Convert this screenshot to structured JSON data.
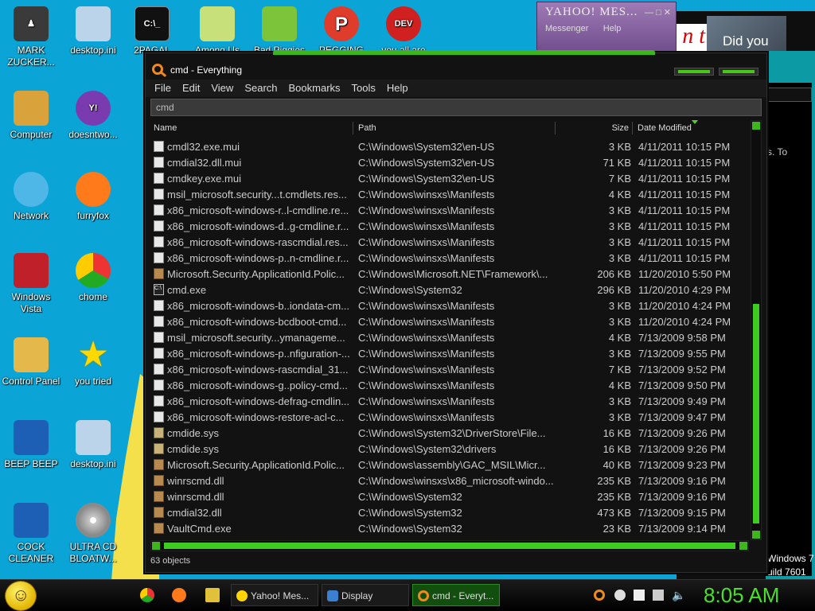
{
  "desktop_icons": [
    {
      "name": "desktop-icon-mark-zuckerberg",
      "label": "MARK ZUCKER..."
    },
    {
      "name": "desktop-icon-desktop-ini-1",
      "label": "desktop.ini"
    },
    {
      "name": "desktop-icon-2pagal",
      "label": "2PAGAL"
    },
    {
      "name": "desktop-icon-among-us",
      "label": "Among Us"
    },
    {
      "name": "desktop-icon-bad-piggies",
      "label": "Bad Piggies"
    },
    {
      "name": "desktop-icon-pegging",
      "label": "PEGGING"
    },
    {
      "name": "desktop-icon-you-all-are",
      "label": "you all are"
    },
    {
      "name": "desktop-icon-computer",
      "label": "Computer"
    },
    {
      "name": "desktop-icon-doesntwo",
      "label": "doesntwo..."
    },
    {
      "name": "desktop-icon-network",
      "label": "Network"
    },
    {
      "name": "desktop-icon-furryfox",
      "label": "furryfox"
    },
    {
      "name": "desktop-icon-windows-vista",
      "label": "Windows Vista"
    },
    {
      "name": "desktop-icon-chome",
      "label": "chome"
    },
    {
      "name": "desktop-icon-control-panel",
      "label": "Control Panel"
    },
    {
      "name": "desktop-icon-you-tried",
      "label": "you tried"
    },
    {
      "name": "desktop-icon-beep-beep",
      "label": "BEEP BEEP"
    },
    {
      "name": "desktop-icon-desktop-ini-2",
      "label": "desktop.ini"
    },
    {
      "name": "desktop-icon-cock-cleaner",
      "label": "COCK CLEANER"
    },
    {
      "name": "desktop-icon-ultra-cd",
      "label": "ULTRA CD BLOATW..."
    }
  ],
  "yahoo_window": {
    "title": "YAHOO! MES...",
    "menu_messenger": "Messenger",
    "menu_help": "Help"
  },
  "bg_window": {
    "photo_text": "Did you",
    "side_text": "s. To",
    "version_line1": "Windows 7",
    "version_line2": "uild 7601"
  },
  "everything": {
    "title": "cmd - Everything",
    "menu": [
      "File",
      "Edit",
      "View",
      "Search",
      "Bookmarks",
      "Tools",
      "Help"
    ],
    "search_value": "cmd",
    "columns": {
      "name": "Name",
      "path": "Path",
      "size": "Size",
      "date": "Date Modified"
    },
    "rows": [
      {
        "icon": "file",
        "name": "cmdl32.exe.mui",
        "path": "C:\\Windows\\System32\\en-US",
        "size": "3 KB",
        "date": "4/11/2011 10:15 PM"
      },
      {
        "icon": "file",
        "name": "cmdial32.dll.mui",
        "path": "C:\\Windows\\System32\\en-US",
        "size": "71 KB",
        "date": "4/11/2011 10:15 PM"
      },
      {
        "icon": "file",
        "name": "cmdkey.exe.mui",
        "path": "C:\\Windows\\System32\\en-US",
        "size": "7 KB",
        "date": "4/11/2011 10:15 PM"
      },
      {
        "icon": "file",
        "name": "msil_microsoft.security...t.cmdlets.res...",
        "path": "C:\\Windows\\winsxs\\Manifests",
        "size": "4 KB",
        "date": "4/11/2011 10:15 PM"
      },
      {
        "icon": "file",
        "name": "x86_microsoft-windows-r..l-cmdline.re...",
        "path": "C:\\Windows\\winsxs\\Manifests",
        "size": "3 KB",
        "date": "4/11/2011 10:15 PM"
      },
      {
        "icon": "file",
        "name": "x86_microsoft-windows-d..g-cmdline.r...",
        "path": "C:\\Windows\\winsxs\\Manifests",
        "size": "3 KB",
        "date": "4/11/2011 10:15 PM"
      },
      {
        "icon": "file",
        "name": "x86_microsoft-windows-rascmdial.res...",
        "path": "C:\\Windows\\winsxs\\Manifests",
        "size": "3 KB",
        "date": "4/11/2011 10:15 PM"
      },
      {
        "icon": "file",
        "name": "x86_microsoft-windows-p..n-cmdline.r...",
        "path": "C:\\Windows\\winsxs\\Manifests",
        "size": "3 KB",
        "date": "4/11/2011 10:15 PM"
      },
      {
        "icon": "dll",
        "name": "Microsoft.Security.ApplicationId.Polic...",
        "path": "C:\\Windows\\Microsoft.NET\\Framework\\...",
        "size": "206 KB",
        "date": "11/20/2010 5:50 PM"
      },
      {
        "icon": "exe",
        "name": "cmd.exe",
        "path": "C:\\Windows\\System32",
        "size": "296 KB",
        "date": "11/20/2010 4:29 PM"
      },
      {
        "icon": "file",
        "name": "x86_microsoft-windows-b..iondata-cm...",
        "path": "C:\\Windows\\winsxs\\Manifests",
        "size": "3 KB",
        "date": "11/20/2010 4:24 PM"
      },
      {
        "icon": "file",
        "name": "x86_microsoft-windows-bcdboot-cmd...",
        "path": "C:\\Windows\\winsxs\\Manifests",
        "size": "3 KB",
        "date": "11/20/2010 4:24 PM"
      },
      {
        "icon": "file",
        "name": "msil_microsoft.security...ymanageme...",
        "path": "C:\\Windows\\winsxs\\Manifests",
        "size": "4 KB",
        "date": "7/13/2009 9:58 PM"
      },
      {
        "icon": "file",
        "name": "x86_microsoft-windows-p..nfiguration-...",
        "path": "C:\\Windows\\winsxs\\Manifests",
        "size": "3 KB",
        "date": "7/13/2009 9:55 PM"
      },
      {
        "icon": "file",
        "name": "x86_microsoft-windows-rascmdial_31...",
        "path": "C:\\Windows\\winsxs\\Manifests",
        "size": "7 KB",
        "date": "7/13/2009 9:52 PM"
      },
      {
        "icon": "file",
        "name": "x86_microsoft-windows-g..policy-cmd...",
        "path": "C:\\Windows\\winsxs\\Manifests",
        "size": "4 KB",
        "date": "7/13/2009 9:50 PM"
      },
      {
        "icon": "file",
        "name": "x86_microsoft-windows-defrag-cmdlin...",
        "path": "C:\\Windows\\winsxs\\Manifests",
        "size": "3 KB",
        "date": "7/13/2009 9:49 PM"
      },
      {
        "icon": "file",
        "name": "x86_microsoft-windows-restore-acl-c...",
        "path": "C:\\Windows\\winsxs\\Manifests",
        "size": "3 KB",
        "date": "7/13/2009 9:47 PM"
      },
      {
        "icon": "sys",
        "name": "cmdide.sys",
        "path": "C:\\Windows\\System32\\DriverStore\\File...",
        "size": "16 KB",
        "date": "7/13/2009 9:26 PM"
      },
      {
        "icon": "sys",
        "name": "cmdide.sys",
        "path": "C:\\Windows\\System32\\drivers",
        "size": "16 KB",
        "date": "7/13/2009 9:26 PM"
      },
      {
        "icon": "dll",
        "name": "Microsoft.Security.ApplicationId.Polic...",
        "path": "C:\\Windows\\assembly\\GAC_MSIL\\Micr...",
        "size": "40 KB",
        "date": "7/13/2009 9:23 PM"
      },
      {
        "icon": "dll",
        "name": "winrscmd.dll",
        "path": "C:\\Windows\\winsxs\\x86_microsoft-windo...",
        "size": "235 KB",
        "date": "7/13/2009 9:16 PM"
      },
      {
        "icon": "dll",
        "name": "winrscmd.dll",
        "path": "C:\\Windows\\System32",
        "size": "235 KB",
        "date": "7/13/2009 9:16 PM"
      },
      {
        "icon": "dll",
        "name": "cmdial32.dll",
        "path": "C:\\Windows\\System32",
        "size": "473 KB",
        "date": "7/13/2009 9:15 PM"
      },
      {
        "icon": "dll",
        "name": "VaultCmd.exe",
        "path": "C:\\Windows\\System32",
        "size": "23 KB",
        "date": "7/13/2009 9:14 PM"
      }
    ],
    "status": "63 objects"
  },
  "taskbar": {
    "buttons": [
      {
        "name": "taskbar-yahoo-messenger",
        "label": "Yahoo! Mes...",
        "active": false
      },
      {
        "name": "taskbar-display",
        "label": "Display",
        "active": false
      },
      {
        "name": "taskbar-everything",
        "label": "cmd - Everyt...",
        "active": true
      }
    ],
    "clock": "8:05 AM"
  },
  "colors": {
    "accent_green": "#3fcc22",
    "desktop_blue": "#0aa4d6",
    "clock_green": "#49df2b"
  }
}
